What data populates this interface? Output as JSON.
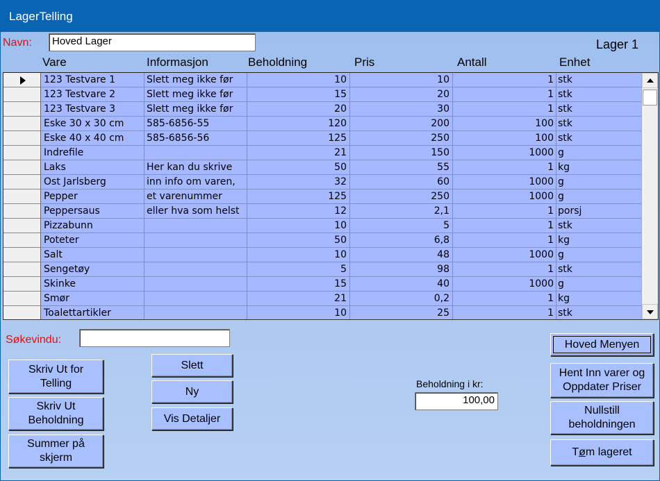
{
  "window": {
    "title": "LagerTelling"
  },
  "header": {
    "name_label": "Navn:",
    "name_value": "Hoved Lager",
    "lager_label": "Lager 1"
  },
  "grid": {
    "columns": [
      "Vare",
      "Informasjon",
      "Beholdning",
      "Pris",
      "Antall",
      "Enhet"
    ],
    "rows": [
      {
        "vare": "123 Testvare 1",
        "info": "Slett meg ikke før",
        "beh": "10",
        "pris": "10",
        "ant": "1",
        "enh": "stk"
      },
      {
        "vare": "123 Testvare 2",
        "info": "Slett meg ikke før",
        "beh": "15",
        "pris": "20",
        "ant": "1",
        "enh": "stk"
      },
      {
        "vare": "123 Testvare 3",
        "info": "Slett meg ikke før",
        "beh": "20",
        "pris": "30",
        "ant": "1",
        "enh": "stk"
      },
      {
        "vare": "Eske 30 x 30 cm",
        "info": "585-6856-55",
        "beh": "120",
        "pris": "200",
        "ant": "100",
        "enh": "stk"
      },
      {
        "vare": "Eske 40 x 40 cm",
        "info": "585-6856-56",
        "beh": "125",
        "pris": "250",
        "ant": "100",
        "enh": "stk"
      },
      {
        "vare": "Indrefile",
        "info": "",
        "beh": "21",
        "pris": "150",
        "ant": "1000",
        "enh": "g"
      },
      {
        "vare": "Laks",
        "info": "Her kan du skrive",
        "beh": "50",
        "pris": "55",
        "ant": "1",
        "enh": "kg"
      },
      {
        "vare": "Ost Jarlsberg",
        "info": "inn info om varen,",
        "beh": "32",
        "pris": "60",
        "ant": "1000",
        "enh": "g"
      },
      {
        "vare": "Pepper",
        "info": "et varenummer",
        "beh": "125",
        "pris": "250",
        "ant": "1000",
        "enh": "g"
      },
      {
        "vare": "Peppersaus",
        "info": "eller hva som helst",
        "beh": "12",
        "pris": "2,1",
        "ant": "1",
        "enh": "porsj"
      },
      {
        "vare": "Pizzabunn",
        "info": "",
        "beh": "10",
        "pris": "5",
        "ant": "1",
        "enh": "stk"
      },
      {
        "vare": "Poteter",
        "info": "",
        "beh": "50",
        "pris": "6,8",
        "ant": "1",
        "enh": "kg"
      },
      {
        "vare": "Salt",
        "info": "",
        "beh": "10",
        "pris": "48",
        "ant": "1000",
        "enh": "g"
      },
      {
        "vare": "Sengetøy",
        "info": "",
        "beh": "5",
        "pris": "98",
        "ant": "1",
        "enh": "stk"
      },
      {
        "vare": "Skinke",
        "info": "",
        "beh": "15",
        "pris": "40",
        "ant": "1000",
        "enh": "g"
      },
      {
        "vare": "Smør",
        "info": "",
        "beh": "21",
        "pris": "0,2",
        "ant": "1",
        "enh": "kg"
      },
      {
        "vare": "Toalettartikler",
        "info": "",
        "beh": "10",
        "pris": "25",
        "ant": "1",
        "enh": "stk"
      }
    ]
  },
  "search": {
    "label": "Søkevindu:",
    "value": ""
  },
  "buttons": {
    "print_count_1": "Skriv Ut for",
    "print_count_2": "Telling",
    "print_stock_1": "Skriv Ut",
    "print_stock_2": "Beholdning",
    "sum_screen_1": "Summer på",
    "sum_screen_2": "skjerm",
    "delete": "Slett",
    "new": "Ny",
    "details": "Vis Detaljer",
    "main_menu": "Hoved Menyen",
    "import_1": "Hent Inn varer og",
    "import_2": "Oppdater Priser",
    "reset_1": "Nullstill",
    "reset_2": "beholdningen",
    "empty_pre": "T",
    "empty_u": "ø",
    "empty_post": "m lageret"
  },
  "stock_value": {
    "label": "Beholdning i kr:",
    "value": "100,00"
  }
}
